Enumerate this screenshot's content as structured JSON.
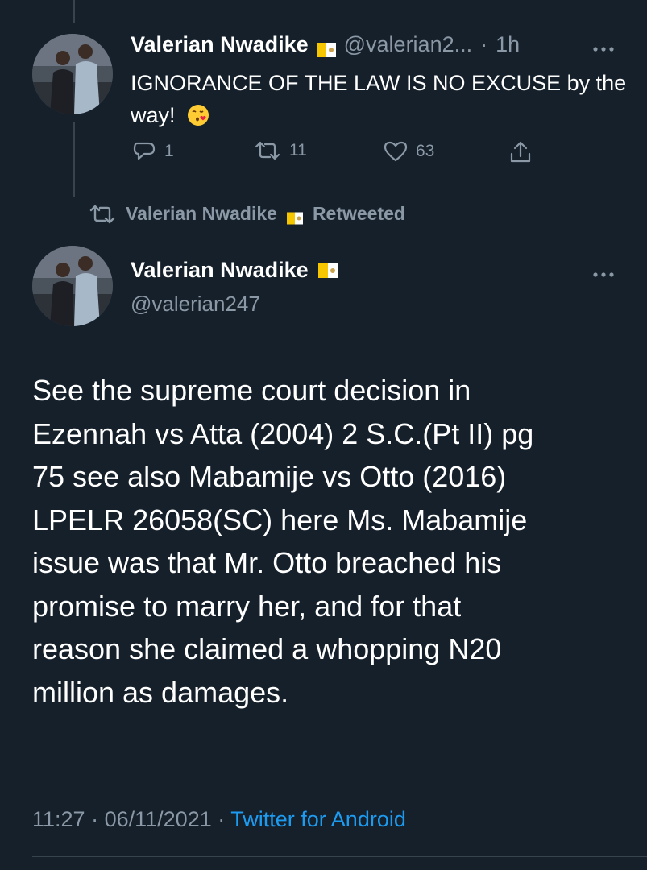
{
  "tweet1": {
    "display_name": "Valerian Nwadike",
    "handle_truncated": "@valerian2...",
    "separator": "·",
    "time_ago": "1h",
    "text": "IGNORANCE OF THE LAW IS NO EXCUSE by the way!",
    "emoji": "kissing-face-with-heart-emoji",
    "replies": "1",
    "retweets": "11",
    "likes": "63"
  },
  "retweet_banner": {
    "name": "Valerian Nwadike",
    "label": "Retweeted"
  },
  "tweet2": {
    "display_name": "Valerian Nwadike",
    "handle": "@valerian247",
    "text": "See the supreme court decision in\nEzennah vs Atta (2004) 2 S.C.(Pt II) pg\n75 see also Mabamije vs Otto (2016)\nLPELR 26058(SC)  here Ms. Mabamije\nissue was that Mr. Otto breached his\npromise to marry her, and for that\nreason she claimed a whopping N20\nmillion as damages.",
    "time": "11:27",
    "date": "06/11/2021",
    "dot": "·",
    "source": "Twitter for Android"
  },
  "colors": {
    "background": "#15202b",
    "text": "#ffffff",
    "muted": "#8b98a5",
    "link": "#1d9bf0",
    "divider": "#38444d"
  }
}
